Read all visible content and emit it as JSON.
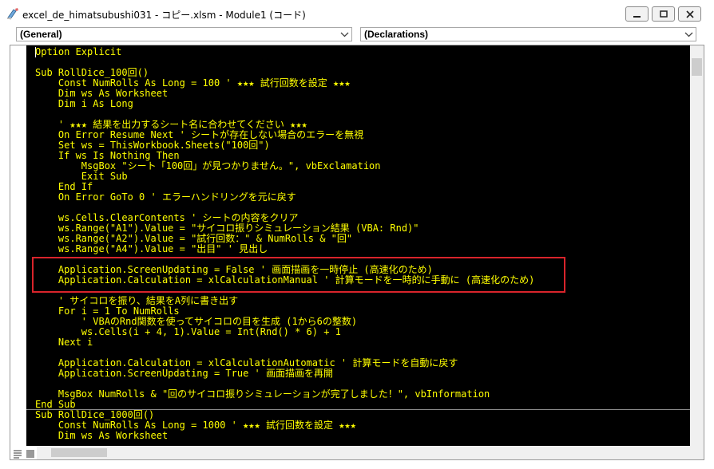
{
  "window": {
    "title": "excel_de_himatsubushi031 - コピー.xlsm - Module1 (コード)"
  },
  "selectors": {
    "object": "(General)",
    "procedure": "(Declarations)"
  },
  "colors": {
    "code_background": "#000000",
    "code_text": "#ffff00",
    "highlight_border": "#d9242b"
  },
  "code": {
    "lines": [
      "Option Explicit",
      "",
      "Sub RollDice_100回()",
      "    Const NumRolls As Long = 100 ' ★★★ 試行回数を設定 ★★★",
      "    Dim ws As Worksheet",
      "    Dim i As Long",
      "",
      "    ' ★★★ 結果を出力するシート名に合わせてください ★★★",
      "    On Error Resume Next ' シートが存在しない場合のエラーを無視",
      "    Set ws = ThisWorkbook.Sheets(\"100回\")",
      "    If ws Is Nothing Then",
      "        MsgBox \"シート「100回」が見つかりません。\", vbExclamation",
      "        Exit Sub",
      "    End If",
      "    On Error GoTo 0 ' エラーハンドリングを元に戻す",
      "",
      "    ws.Cells.ClearContents ' シートの内容をクリア",
      "    ws.Range(\"A1\").Value = \"サイコロ振りシミュレーション結果 (VBA: Rnd)\"",
      "    ws.Range(\"A2\").Value = \"試行回数：\" & NumRolls & \"回\"",
      "    ws.Range(\"A4\").Value = \"出目\" ' 見出し",
      "",
      "    Application.ScreenUpdating = False ' 画面描画を一時停止 (高速化のため)",
      "    Application.Calculation = xlCalculationManual ' 計算モードを一時的に手動に (高速化のため)",
      "",
      "    ' サイコロを振り、結果をA列に書き出す",
      "    For i = 1 To NumRolls",
      "        ' VBAのRnd関数を使ってサイコロの目を生成 (1から6の整数)",
      "        ws.Cells(i + 4, 1).Value = Int(Rnd() * 6) + 1",
      "    Next i",
      "",
      "    Application.Calculation = xlCalculationAutomatic ' 計算モードを自動に戻す",
      "    Application.ScreenUpdating = True ' 画面描画を再開",
      "",
      "    MsgBox NumRolls & \"回のサイコロ振りシミュレーションが完了しました！\", vbInformation",
      "End Sub",
      "Sub RollDice_1000回()",
      "    Const NumRolls As Long = 1000 ' ★★★ 試行回数を設定 ★★★",
      "    Dim ws As Worksheet"
    ]
  }
}
